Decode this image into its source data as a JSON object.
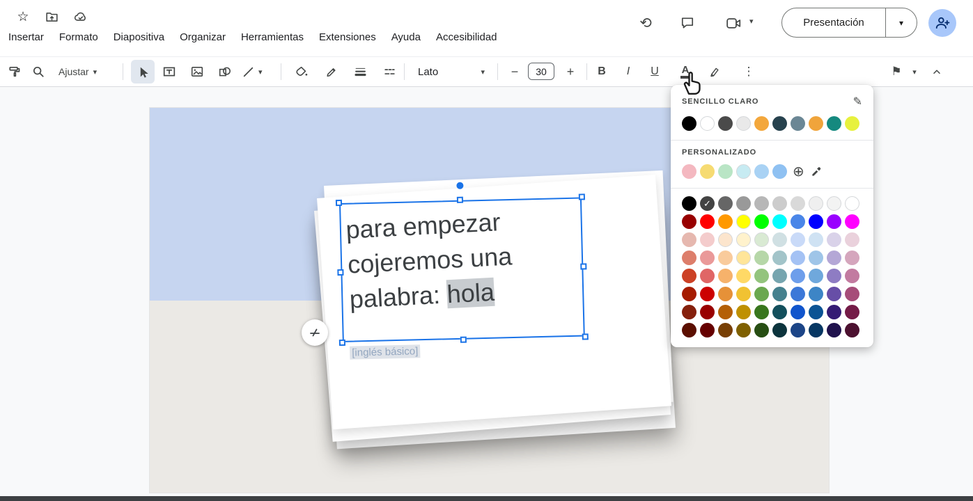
{
  "glyphs": {
    "star": "☆",
    "history": "⟲",
    "caret_down": "▾",
    "more_vertical": "⋮",
    "plus_circle": "⊕",
    "flag": "⚑",
    "minus": "−",
    "plus": "+",
    "pencil_edit": "✎",
    "text_color_letter": "A"
  },
  "header": {
    "menus": [
      "Insertar",
      "Formato",
      "Diapositiva",
      "Organizar",
      "Herramientas",
      "Extensiones",
      "Ayuda",
      "Accesibilidad"
    ],
    "present_button": "Presentación"
  },
  "toolbar": {
    "fit": "Ajustar",
    "font": "Lato",
    "font_size": "30",
    "bold": "B",
    "italic": "I",
    "underline": "U"
  },
  "color_panel": {
    "simple_light_title": "SENCILLO CLARO",
    "custom_title": "PERSONALIZADO",
    "theme_colors": [
      "#000000",
      "#ffffff",
      "#4a4a4a",
      "#e9e9e9",
      "#f3a73c",
      "#27424e",
      "#6b8795",
      "#f0a43b",
      "#15897f",
      "#e7f13d"
    ],
    "custom_colors": [
      "#f4b8c0",
      "#f6db72",
      "#b9e5c5",
      "#c7ebf2",
      "#a9d2f4",
      "#8fc1f2"
    ],
    "palette": [
      [
        "#000000",
        "#434343",
        "#666666",
        "#999999",
        "#b7b7b7",
        "#cccccc",
        "#d9d9d9",
        "#efefef",
        "#f3f3f3",
        "#ffffff"
      ],
      [
        "#980000",
        "#ff0000",
        "#ff9900",
        "#ffff00",
        "#00ff00",
        "#00ffff",
        "#4a86e8",
        "#0000ff",
        "#9900ff",
        "#ff00ff"
      ],
      [
        "#e6b8af",
        "#f4cccc",
        "#fce5cd",
        "#fff2cc",
        "#d9ead3",
        "#d0e0e3",
        "#c9daf8",
        "#cfe2f3",
        "#d9d2e9",
        "#ead1dc"
      ],
      [
        "#dd7e6b",
        "#ea9999",
        "#f9cb9c",
        "#ffe599",
        "#b6d7a8",
        "#a2c4c9",
        "#a4c2f4",
        "#9fc5e8",
        "#b4a7d6",
        "#d5a6bd"
      ],
      [
        "#cc4125",
        "#e06666",
        "#f6b26b",
        "#ffd966",
        "#93c47d",
        "#76a5af",
        "#6d9eeb",
        "#6fa8dc",
        "#8e7cc3",
        "#c27ba0"
      ],
      [
        "#a61c00",
        "#cc0000",
        "#e69138",
        "#f1c232",
        "#6aa84f",
        "#45818e",
        "#3c78d8",
        "#3d85c6",
        "#674ea7",
        "#a64d79"
      ],
      [
        "#85200c",
        "#990000",
        "#b45f06",
        "#bf9000",
        "#38761d",
        "#134f5c",
        "#1155cc",
        "#0b5394",
        "#351c75",
        "#741b47"
      ],
      [
        "#5b0f00",
        "#660000",
        "#783f04",
        "#7f6000",
        "#274e13",
        "#0c343d",
        "#1c4587",
        "#073763",
        "#20124d",
        "#4c1130"
      ]
    ],
    "selected_color": "#434343"
  },
  "slide": {
    "line1": "para empezar",
    "line2": "cojeremos una",
    "line3_prefix": "palabra: ",
    "line3_highlight": "hola",
    "footnote": "[inglés básico]",
    "bg_top": "#c6d5f0",
    "bg_bottom": "#ebe9e5"
  },
  "colors": {
    "accent": "#1a73e8",
    "selection_gray": "#c8ccd0",
    "avatar_blue": "#a8c7fa"
  }
}
